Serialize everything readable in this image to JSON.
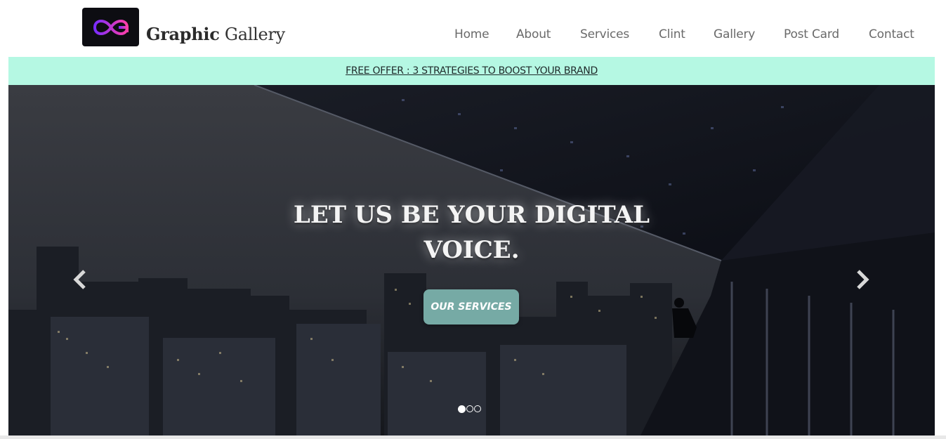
{
  "brand": {
    "name_bold": "Graphic",
    "name_rest": "Gallery",
    "logo_icon": "infinity-g-logo-icon"
  },
  "nav": {
    "items": [
      {
        "label": "Home"
      },
      {
        "label": "About"
      },
      {
        "label": "Services"
      },
      {
        "label": "Clint"
      },
      {
        "label": "Gallery"
      },
      {
        "label": "Post Card"
      },
      {
        "label": "Contact"
      }
    ]
  },
  "offer": {
    "text": "FREE OFFER : 3 STRATEGIES TO BOOST YOUR BRAND"
  },
  "hero": {
    "headline_line1": "LET US BE YOUR DIGITAL",
    "headline_line2": "VOICE.",
    "cta_label": "OUR SERVICES",
    "prev_icon": "chevron-left-icon",
    "next_icon": "chevron-right-icon",
    "slide_count": 3,
    "active_slide": 1
  },
  "colors": {
    "offer_bg": "#b5f8e3",
    "cta_bg": "#76aaa5"
  }
}
